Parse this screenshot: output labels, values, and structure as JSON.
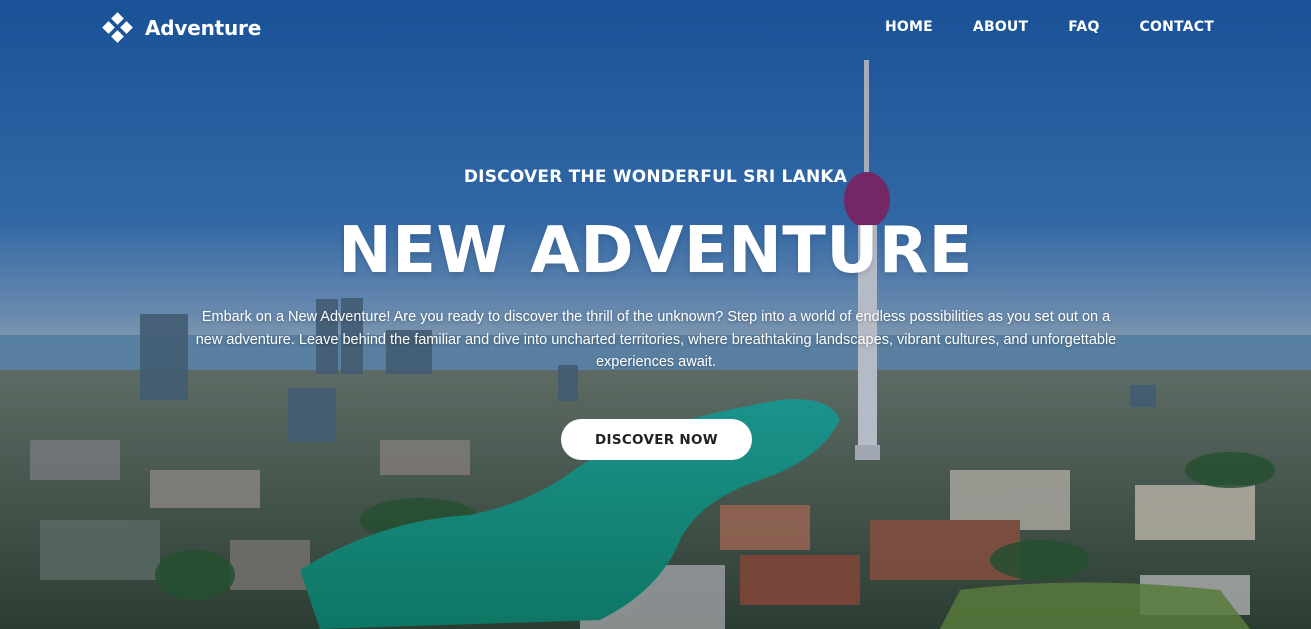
{
  "brand": {
    "name": "Adventure",
    "icon": "diamond-cluster-icon"
  },
  "nav": {
    "items": [
      {
        "label": "HOME"
      },
      {
        "label": "ABOUT"
      },
      {
        "label": "FAQ"
      },
      {
        "label": "CONTACT"
      }
    ]
  },
  "hero": {
    "eyebrow": "DISCOVER THE WONDERFUL SRI LANKA",
    "title": "NEW ADVENTURE",
    "description": "Embark on a New Adventure! Are you ready to discover the thrill of the unknown? Step into a world of endless possibilities as you set out on a new adventure. Leave behind the familiar and dive into uncharted territories, where breathtaking landscapes, vibrant cultures, and unforgettable experiences await.",
    "cta_label": "DISCOVER NOW",
    "background": "colombo-city-skyline-photo"
  },
  "colors": {
    "sky": "#1f5fa8",
    "water": "#17a488",
    "cta_bg": "#ffffff",
    "cta_text": "#222222"
  }
}
